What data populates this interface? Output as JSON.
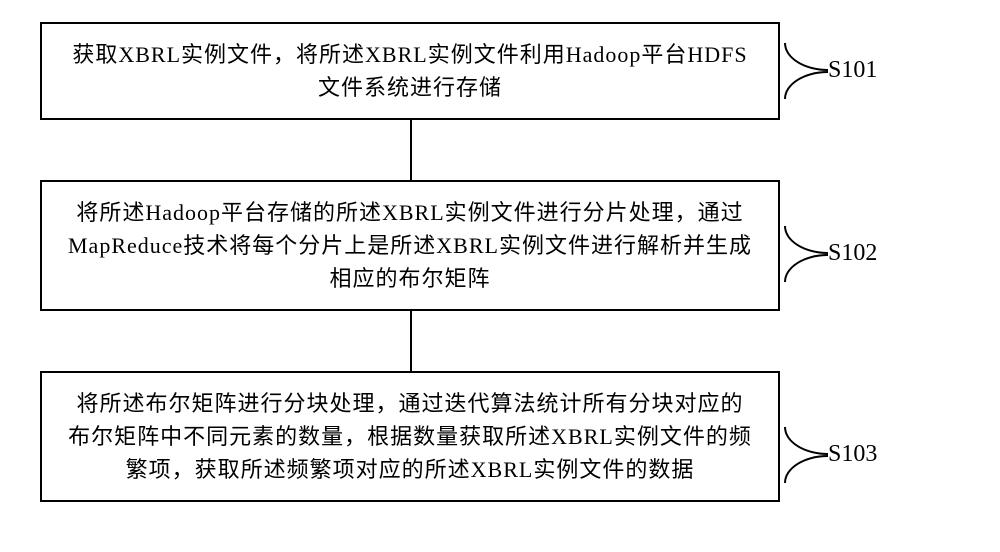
{
  "steps": [
    {
      "id": "s101",
      "label": "S101",
      "text": "获取XBRL实例文件，将所述XBRL实例文件利用Hadoop平台HDFS文件系统进行存储"
    },
    {
      "id": "s102",
      "label": "S102",
      "text": "将所述Hadoop平台存储的所述XBRL实例文件进行分片处理，通过MapReduce技术将每个分片上是所述XBRL实例文件进行解析并生成相应的布尔矩阵"
    },
    {
      "id": "s103",
      "label": "S103",
      "text": "将所述布尔矩阵进行分块处理，通过迭代算法统计所有分块对应的布尔矩阵中不同元素的数量，根据数量获取所述XBRL实例文件的频繁项，获取所述频繁项对应的所述XBRL实例文件的数据"
    }
  ]
}
